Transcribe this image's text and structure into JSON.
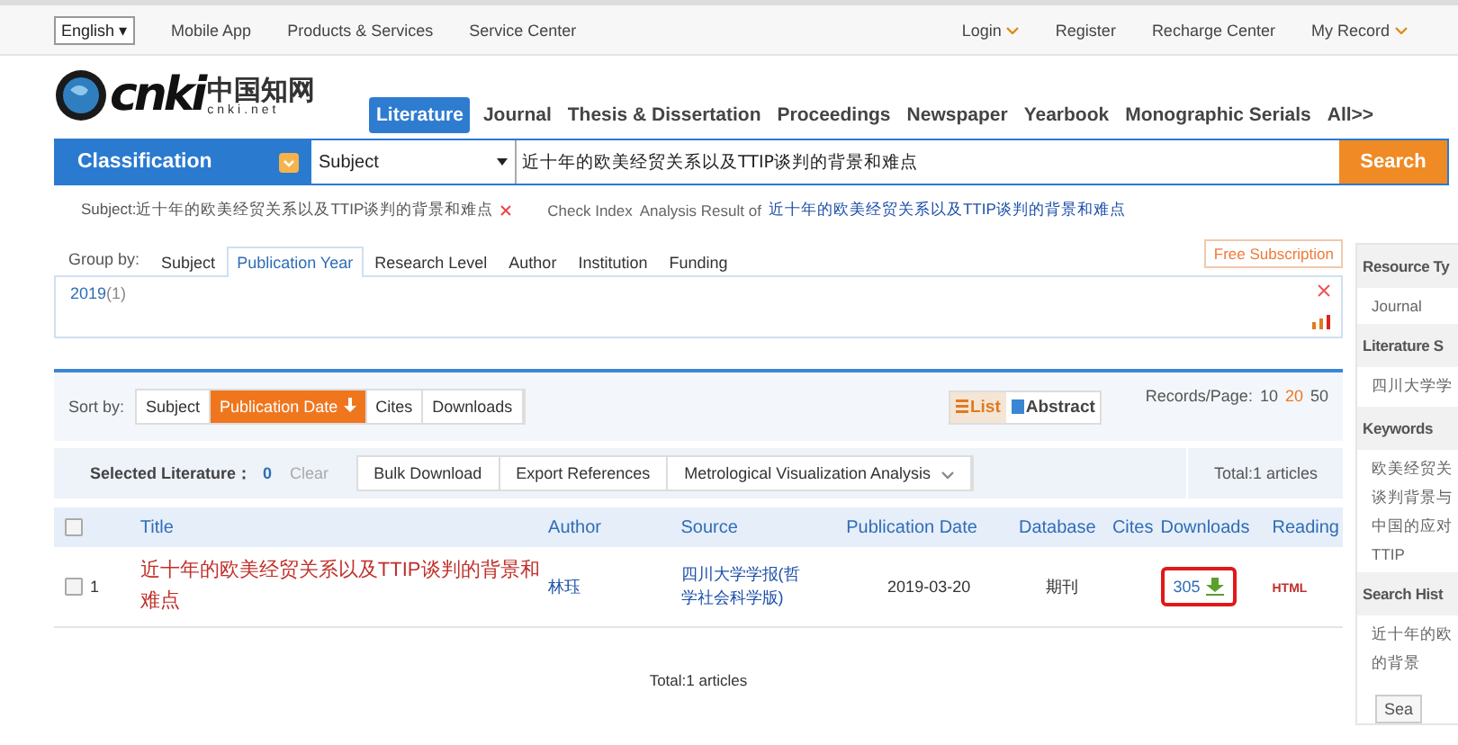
{
  "top_bar": {
    "language": "English ▾",
    "left_links": [
      "Mobile App",
      "Products & Services",
      "Service Center"
    ],
    "right_links": [
      {
        "label": "Login",
        "dropdown": true
      },
      {
        "label": "Register",
        "dropdown": false
      },
      {
        "label": "Recharge Center",
        "dropdown": false
      },
      {
        "label": "My Record",
        "dropdown": true
      }
    ]
  },
  "logo": {
    "mark": "cnki",
    "chinese": "中国知网",
    "domain": "cnki.net"
  },
  "db_tabs": [
    {
      "label": "Literature",
      "selected": true
    },
    {
      "label": "Journal",
      "selected": false
    },
    {
      "label": "Thesis & Dissertation",
      "selected": false
    },
    {
      "label": "Proceedings",
      "selected": false
    },
    {
      "label": "Newspaper",
      "selected": false
    },
    {
      "label": "Yearbook",
      "selected": false
    },
    {
      "label": "Monographic Serials",
      "selected": false
    },
    {
      "label": "All>>",
      "selected": false
    }
  ],
  "search": {
    "classification": "Classification",
    "field": "Subject",
    "query": "近十年的欧美经贸关系以及TTIP谈判的背景和难点",
    "button": "Search"
  },
  "criteria": {
    "subject": "Subject:近十年的欧美经贸关系以及TTIP谈判的背景和难点",
    "check_index": "Check Index",
    "analysis": "Analysis Result of",
    "analysis_link": "近十年的欧美经贸关系以及TTIP谈判的背景和难点"
  },
  "group_by": {
    "label": "Group by:",
    "tabs": [
      {
        "label": "Subject",
        "selected": false
      },
      {
        "label": "Publication Year",
        "selected": true
      },
      {
        "label": "Research Level",
        "selected": false
      },
      {
        "label": "Author",
        "selected": false
      },
      {
        "label": "Institution",
        "selected": false
      },
      {
        "label": "Funding",
        "selected": false
      }
    ],
    "subscription": "Free Subscription",
    "year": "2019",
    "year_count": "(1)"
  },
  "sort": {
    "label": "Sort by:",
    "options": [
      {
        "label": "Subject",
        "selected": false
      },
      {
        "label": "Publication Date",
        "selected": true
      },
      {
        "label": "Cites",
        "selected": false
      },
      {
        "label": "Downloads",
        "selected": false
      }
    ],
    "views": [
      {
        "label": "List",
        "selected": true
      },
      {
        "label": "Abstract",
        "selected": false
      }
    ],
    "records_label": "Records/Page:",
    "page_sizes": [
      {
        "label": "10",
        "selected": false
      },
      {
        "label": "20",
        "selected": true
      },
      {
        "label": "50",
        "selected": false
      }
    ]
  },
  "toolbar": {
    "selected_label": "Selected Literature：",
    "selected_count": "0",
    "clear": "Clear",
    "buttons": [
      "Bulk Download",
      "Export References"
    ],
    "analysis": "Metrological Visualization Analysis",
    "total": "Total:1 articles"
  },
  "table": {
    "select_all_checked": false,
    "columns": [
      "Title",
      "Author",
      "Source",
      "Publication Date",
      "Database",
      "Cites",
      "Downloads",
      "Reading"
    ],
    "rows": [
      {
        "checked": false,
        "index": "1",
        "title": "近十年的欧美经贸关系以及TTIP谈判的背景和难点",
        "author": "林珏",
        "source": "四川大学学报(哲学社会科学版)",
        "date": "2019-03-20",
        "database": "期刊",
        "downloads": "305",
        "reading": "HTML"
      }
    ]
  },
  "footer_total": "Total:1 articles",
  "sidebar": [
    {
      "heading": "Resource Ty",
      "items": [
        "Journal"
      ]
    },
    {
      "heading": "Literature S",
      "items": [
        "四川大学学"
      ]
    },
    {
      "heading": "Keywords",
      "items": [
        "欧美经贸关",
        "谈判背景与",
        "中国的应对",
        "TTIP"
      ]
    },
    {
      "heading": "Search Hist",
      "items": [
        "近十年的欧",
        "的背景"
      ]
    }
  ],
  "sidebar_button": "Sea"
}
